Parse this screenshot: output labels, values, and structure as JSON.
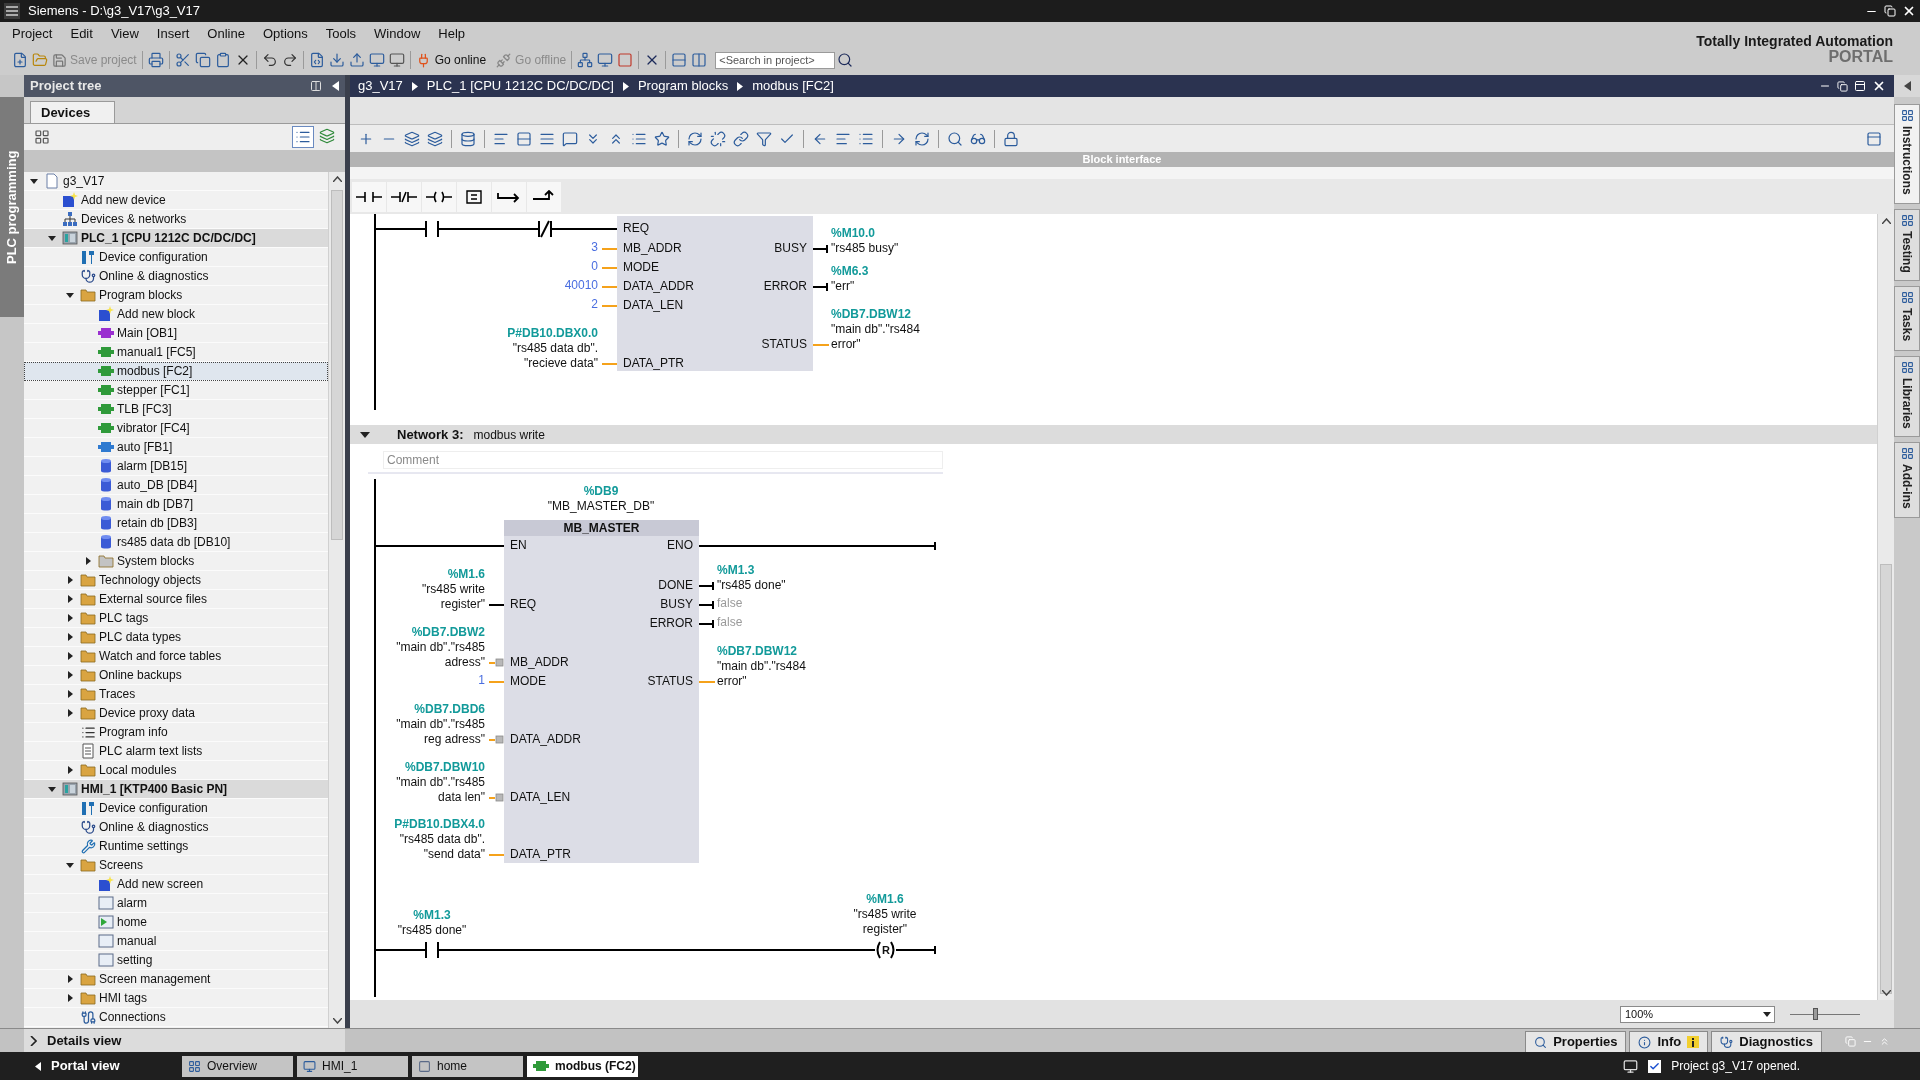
{
  "window": {
    "title": "Siemens - D:\\g3_V17\\g3_V17"
  },
  "menu": [
    "Project",
    "Edit",
    "View",
    "Insert",
    "Online",
    "Options",
    "Tools",
    "Window",
    "Help"
  ],
  "toolbar": {
    "save_project": {
      "label": "Save project",
      "disabled": true
    },
    "go_online": {
      "label": "Go online",
      "disabled": false
    },
    "go_offline": {
      "label": "Go offline",
      "disabled": true
    },
    "search": {
      "placeholder": "<Search in project>"
    }
  },
  "branding": {
    "line_1": "Totally Integrated Automation",
    "line_2": "PORTAL"
  },
  "side_tab": {
    "label": "PLC programming"
  },
  "project_tree": {
    "title": "Project tree",
    "tabs": [
      {
        "label": "Devices",
        "selected": true
      }
    ],
    "items": [
      {
        "label": "g3_V17",
        "kind": "project",
        "expanded": true,
        "selected": false,
        "children": [
          {
            "label": "Add new device",
            "kind": "add",
            "selected": false
          },
          {
            "label": "Devices & networks",
            "kind": "network",
            "selected": false
          },
          {
            "label": "PLC_1 [CPU 1212C DC/DC/DC]",
            "kind": "device",
            "expanded": true,
            "selected": false,
            "children": [
              {
                "label": "Device configuration",
                "kind": "config",
                "selected": false
              },
              {
                "label": "Online & diagnostics",
                "kind": "diagnostics",
                "selected": false
              },
              {
                "label": "Program blocks",
                "kind": "folder",
                "expanded": true,
                "selected": false,
                "children": [
                  {
                    "label": "Add new block",
                    "kind": "add",
                    "selected": false
                  },
                  {
                    "label": "Main [OB1]",
                    "kind": "ob",
                    "selected": false
                  },
                  {
                    "label": "manual1 [FC5]",
                    "kind": "fc",
                    "selected": false
                  },
                  {
                    "label": "modbus [FC2]",
                    "kind": "fc",
                    "selected": true
                  },
                  {
                    "label": "stepper [FC1]",
                    "kind": "fc",
                    "selected": false
                  },
                  {
                    "label": "TLB [FC3]",
                    "kind": "fc",
                    "selected": false
                  },
                  {
                    "label": "vibrator [FC4]",
                    "kind": "fc",
                    "selected": false
                  },
                  {
                    "label": "auto [FB1]",
                    "kind": "fb",
                    "selected": false
                  },
                  {
                    "label": "alarm [DB15]",
                    "kind": "db",
                    "selected": false
                  },
                  {
                    "label": "auto_DB [DB4]",
                    "kind": "db",
                    "selected": false
                  },
                  {
                    "label": "main db [DB7]",
                    "kind": "db",
                    "selected": false
                  },
                  {
                    "label": "retain db [DB3]",
                    "kind": "db",
                    "selected": false
                  },
                  {
                    "label": "rs485 data db [DB10]",
                    "kind": "db",
                    "selected": false
                  },
                  {
                    "label": "System blocks",
                    "kind": "system",
                    "expanded": false,
                    "selected": false
                  }
                ]
              },
              {
                "label": "Technology objects",
                "kind": "folder",
                "expanded": false,
                "selected": false
              },
              {
                "label": "External source files",
                "kind": "folder",
                "expanded": false,
                "selected": false
              },
              {
                "label": "PLC tags",
                "kind": "folder",
                "expanded": false,
                "selected": false
              },
              {
                "label": "PLC data types",
                "kind": "folder",
                "expanded": false,
                "selected": false
              },
              {
                "label": "Watch and force tables",
                "kind": "folder",
                "expanded": false,
                "selected": false
              },
              {
                "label": "Online backups",
                "kind": "folder",
                "expanded": false,
                "selected": false
              },
              {
                "label": "Traces",
                "kind": "folder",
                "expanded": false,
                "selected": false
              },
              {
                "label": "Device proxy data",
                "kind": "folder",
                "expanded": false,
                "selected": false
              },
              {
                "label": "Program info",
                "kind": "info",
                "selected": false
              },
              {
                "label": "PLC alarm text lists",
                "kind": "document",
                "selected": false
              },
              {
                "label": "Local modules",
                "kind": "folder",
                "expanded": false,
                "selected": false
              }
            ]
          },
          {
            "label": "HMI_1 [KTP400 Basic PN]",
            "kind": "device",
            "expanded": true,
            "selected": false,
            "children": [
              {
                "label": "Device configuration",
                "kind": "config",
                "selected": false
              },
              {
                "label": "Online & diagnostics",
                "kind": "diagnostics",
                "selected": false
              },
              {
                "label": "Runtime settings",
                "kind": "runtime",
                "selected": false
              },
              {
                "label": "Screens",
                "kind": "folder",
                "expanded": true,
                "selected": false,
                "children": [
                  {
                    "label": "Add new screen",
                    "kind": "add",
                    "selected": false
                  },
                  {
                    "label": "alarm",
                    "kind": "screen",
                    "selected": false
                  },
                  {
                    "label": "home",
                    "kind": "start_screen",
                    "selected": false
                  },
                  {
                    "label": "manual",
                    "kind": "screen",
                    "selected": false
                  },
                  {
                    "label": "setting",
                    "kind": "screen",
                    "selected": false
                  }
                ]
              },
              {
                "label": "Screen management",
                "kind": "folder",
                "expanded": false,
                "selected": false
              },
              {
                "label": "HMI tags",
                "kind": "folder",
                "expanded": false,
                "selected": false
              },
              {
                "label": "Connections",
                "kind": "connections",
                "selected": false
              }
            ]
          }
        ]
      }
    ]
  },
  "editor": {
    "breadcrumb": [
      "g3_V17",
      "PLC_1 [CPU 1212C DC/DC/DC]",
      "Program blocks",
      "modbus [FC2]"
    ],
    "block_interface": "Block interface",
    "networks": [
      {
        "contacts": [
          {
            "kind": "no"
          },
          {
            "kind": "nc"
          }
        ],
        "block": {
          "inputs": [
            {
              "pin": "REQ",
              "kind": "bool"
            },
            {
              "pin": "MB_ADDR",
              "kind": "data",
              "value": "3"
            },
            {
              "pin": "MODE",
              "kind": "data",
              "value": "0"
            },
            {
              "pin": "DATA_ADDR",
              "kind": "data",
              "value": "40010"
            },
            {
              "pin": "DATA_LEN",
              "kind": "data",
              "value": "2"
            },
            {
              "pin": "DATA_PTR",
              "kind": "data",
              "address": "P#DB10.DBX0.0",
              "symbol": [
                "\"rs485 data db\".",
                "\"recieve data\""
              ]
            }
          ],
          "outputs": [
            {
              "pin": "BUSY",
              "kind": "bool",
              "address": "%M10.0",
              "symbol": [
                "\"rs485 busy\""
              ]
            },
            {
              "pin": "ERROR",
              "kind": "bool",
              "address": "%M6.3",
              "symbol": [
                "\"err\""
              ]
            },
            {
              "pin": "STATUS",
              "kind": "data",
              "address": "%DB7.DBW12",
              "symbol": [
                "\"main db\".\"rs484",
                "error\""
              ]
            }
          ]
        }
      },
      {
        "label": "Network 3:",
        "title": "modbus write",
        "expanded": true,
        "comment": {
          "placeholder": "Comment"
        },
        "instance": {
          "address": "%DB9",
          "symbol": "\"MB_MASTER_DB\""
        },
        "block": {
          "name": "MB_MASTER",
          "en": "EN",
          "eno": "ENO",
          "inputs": [
            {
              "pin": "REQ",
              "kind": "bool",
              "address": "%M1.6",
              "symbol": [
                "\"rs485 write",
                "register\""
              ]
            },
            {
              "pin": "MB_ADDR",
              "kind": "data",
              "converted": true,
              "address": "%DB7.DBW2",
              "symbol": [
                "\"main db\".\"rs485",
                "adress\""
              ]
            },
            {
              "pin": "MODE",
              "kind": "data",
              "value": "1"
            },
            {
              "pin": "DATA_ADDR",
              "kind": "data",
              "converted": true,
              "address": "%DB7.DBD6",
              "symbol": [
                "\"main db\".\"rs485",
                "reg adress\""
              ]
            },
            {
              "pin": "DATA_LEN",
              "kind": "data",
              "converted": true,
              "address": "%DB7.DBW10",
              "symbol": [
                "\"main db\".\"rs485",
                "data len\""
              ]
            },
            {
              "pin": "DATA_PTR",
              "kind": "data",
              "address": "P#DB10.DBX4.0",
              "symbol": [
                "\"rs485 data db\".",
                "\"send data\""
              ]
            }
          ],
          "outputs": [
            {
              "pin": "DONE",
              "kind": "bool",
              "address": "%M1.3",
              "symbol": [
                "\"rs485 done\""
              ]
            },
            {
              "pin": "BUSY",
              "kind": "bool",
              "value": "false"
            },
            {
              "pin": "ERROR",
              "kind": "bool",
              "value": "false"
            },
            {
              "pin": "STATUS",
              "kind": "data",
              "address": "%DB7.DBW12",
              "symbol": [
                "\"main db\".\"rs484",
                "error\""
              ]
            }
          ]
        },
        "rung": {
          "contact": {
            "kind": "no",
            "address": "%M1.3",
            "symbol": [
              "\"rs485 done\""
            ]
          },
          "coil": {
            "kind": "reset",
            "letter": "R",
            "address": "%M1.6",
            "symbol": [
              "\"rs485 write",
              "register\""
            ]
          }
        }
      }
    ],
    "zoom": {
      "value": "100%",
      "level": 0.36
    }
  },
  "right_tabs": [
    {
      "label": "Instructions",
      "selected": true
    },
    {
      "label": "Testing",
      "selected": false
    },
    {
      "label": "Tasks",
      "selected": false
    },
    {
      "label": "Libraries",
      "selected": false
    },
    {
      "label": "Add-ins",
      "selected": false
    }
  ],
  "details_view": {
    "label": "Details view",
    "expanded": false
  },
  "inspector_tabs": [
    {
      "label": "Properties",
      "kind": "properties"
    },
    {
      "label": "Info",
      "kind": "info"
    },
    {
      "label": "Diagnostics",
      "kind": "diagnostics"
    }
  ],
  "taskbar": {
    "portal_view": "Portal view",
    "tabs": [
      {
        "label": "Overview",
        "kind": "overview",
        "selected": false
      },
      {
        "label": "HMI_1",
        "kind": "device",
        "selected": false
      },
      {
        "label": "home",
        "kind": "screen",
        "selected": false
      },
      {
        "label": "modbus (FC2)",
        "kind": "block",
        "selected": true
      }
    ],
    "status": "Project g3_V17 opened."
  }
}
